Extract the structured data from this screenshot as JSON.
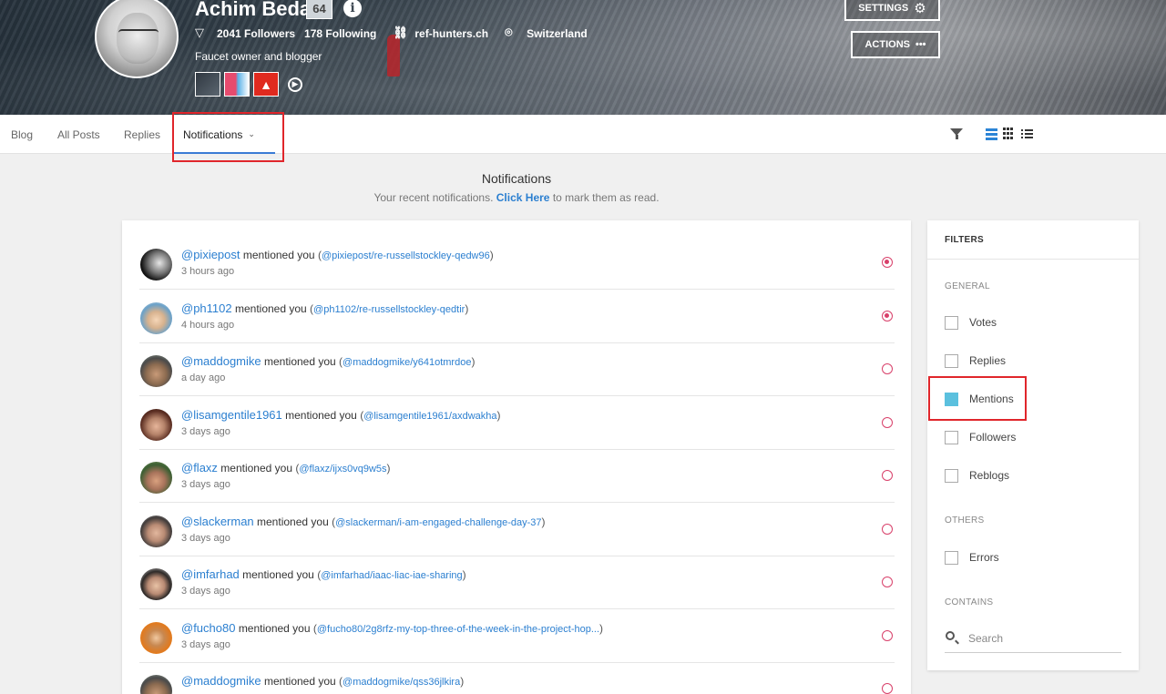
{
  "profile": {
    "name": "Achim Beda",
    "reputation": "64",
    "followers": "2041 Followers",
    "following": "178 Following",
    "website": "ref-hunters.ch",
    "location": "Switzerland",
    "bio": "Faucet owner and blogger"
  },
  "header": {
    "settings_label": "SETTINGS",
    "actions_label": "ACTIONS"
  },
  "tabs": [
    {
      "label": "Blog"
    },
    {
      "label": "All Posts"
    },
    {
      "label": "Replies"
    },
    {
      "label": "Notifications",
      "active": true
    }
  ],
  "page": {
    "title": "Notifications",
    "subtitle_prefix": "Your recent notifications.",
    "subtitle_link": "Click Here",
    "subtitle_suffix": "to mark them as read."
  },
  "notifications": [
    {
      "user": "@pixiepost",
      "action": "mentioned you",
      "permalink": "@pixiepost/re-russellstockley-qedw96",
      "time": "3 hours ago",
      "unread": true
    },
    {
      "user": "@ph1102",
      "action": "mentioned you",
      "permalink": "@ph1102/re-russellstockley-qedtir",
      "time": "4 hours ago",
      "unread": true
    },
    {
      "user": "@maddogmike",
      "action": "mentioned you",
      "permalink": "@maddogmike/y641otmrdoe",
      "time": "a day ago",
      "unread": false
    },
    {
      "user": "@lisamgentile1961",
      "action": "mentioned you",
      "permalink": "@lisamgentile1961/axdwakha",
      "time": "3 days ago",
      "unread": false
    },
    {
      "user": "@flaxz",
      "action": "mentioned you",
      "permalink": "@flaxz/ijxs0vq9w5s",
      "time": "3 days ago",
      "unread": false
    },
    {
      "user": "@slackerman",
      "action": "mentioned you",
      "permalink": "@slackerman/i-am-engaged-challenge-day-37",
      "time": "3 days ago",
      "unread": false
    },
    {
      "user": "@imfarhad",
      "action": "mentioned you",
      "permalink": "@imfarhad/iaac-liac-iae-sharing",
      "time": "3 days ago",
      "unread": false
    },
    {
      "user": "@fucho80",
      "action": "mentioned you",
      "permalink": "@fucho80/2g8rfz-my-top-three-of-the-week-in-the-project-hop...",
      "time": "3 days ago",
      "unread": false
    },
    {
      "user": "@maddogmike",
      "action": "mentioned you",
      "permalink": "@maddogmike/qss36jlkira",
      "time": "",
      "unread": false
    }
  ],
  "filters": {
    "title": "FILTERS",
    "general_label": "GENERAL",
    "general": [
      {
        "label": "Votes",
        "checked": false
      },
      {
        "label": "Replies",
        "checked": false
      },
      {
        "label": "Mentions",
        "checked": true
      },
      {
        "label": "Followers",
        "checked": false
      },
      {
        "label": "Reblogs",
        "checked": false
      }
    ],
    "others_label": "OTHERS",
    "others": [
      {
        "label": "Errors",
        "checked": false
      }
    ],
    "contains_label": "CONTAINS",
    "search_placeholder": "Search"
  },
  "colors": {
    "link": "#2b7fd0",
    "unread_dot": "#d8406a",
    "checkbox_on": "#5bc0de",
    "highlight": "#e0262b"
  }
}
